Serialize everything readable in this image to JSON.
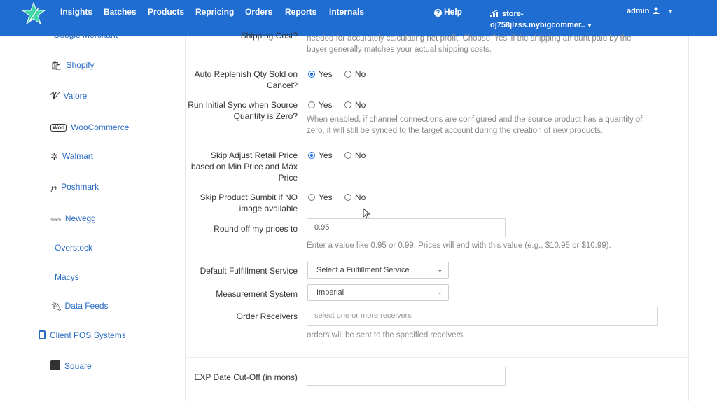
{
  "nav": {
    "items": [
      "Insights",
      "Batches",
      "Products",
      "Repricing",
      "Orders",
      "Reports",
      "Internals"
    ],
    "help": "Help",
    "store_line1": "store-",
    "store_line2": "oj758jlzss.mybigcommer..",
    "admin": "admin"
  },
  "sidebar": {
    "cut_item": "Google Merchant",
    "items": [
      {
        "label": "Shopify",
        "icon": "shopify-icon"
      },
      {
        "label": "Valore",
        "icon": "valore-icon"
      },
      {
        "label": "WooCommerce",
        "icon": "woocommerce-icon"
      },
      {
        "label": "Walmart",
        "icon": "walmart-icon"
      },
      {
        "label": "Poshmark",
        "icon": "poshmark-icon"
      },
      {
        "label": "Newegg",
        "icon": "newegg-icon"
      },
      {
        "label": "Overstock",
        "icon": ""
      },
      {
        "label": "Macys",
        "icon": ""
      },
      {
        "label": "Data Feeds",
        "icon": "plug-icon"
      },
      {
        "label": "Client POS Systems",
        "icon": "tablet-icon"
      },
      {
        "label": "Square",
        "icon": "square-icon"
      }
    ]
  },
  "form": {
    "shipping_cost_label": "Shipping Cost?",
    "shipping_help_1": "needed for accurately calculating net profit. Choose 'Yes' if the shipping amount paid by the",
    "shipping_help_2": "buyer generally matches your actual shipping costs.",
    "auto_replenish_label_1": "Auto Replenish Qty Sold on",
    "auto_replenish_label_2": "Cancel?",
    "initial_sync_label_1": "Run Initial Sync when Source",
    "initial_sync_label_2": "Quantity is Zero?",
    "initial_sync_help_1": "When enabled, if channel connections are configured and the source product has a quantity of",
    "initial_sync_help_2": "zero, it will still be synced to the target account during the creation of new products.",
    "skip_adjust_label_1": "Skip Adjust Retail Price",
    "skip_adjust_label_2": "based on Min Price and Max",
    "skip_adjust_label_3": "Price",
    "skip_submit_label_1": "Skip Product Sumbit if NO",
    "skip_submit_label_2": "image available",
    "round_off_label": "Round off my prices to",
    "round_off_value": "0.95",
    "round_off_help": "Enter a value like 0.95 or 0.99. Prices will end with this value (e.g., $10.95 or $10.99).",
    "fulfillment_label": "Default Fulfillment Service",
    "fulfillment_value": "Select a Fulfillment Service",
    "measurement_label": "Measurement System",
    "measurement_value": "Imperial",
    "receivers_label": "Order Receivers",
    "receivers_placeholder": "select one or more receivers",
    "receivers_help": "orders will be sent to the specified receivers",
    "exp_label": "EXP Date Cut-Off (in mons)",
    "yes": "Yes",
    "no": "No"
  },
  "radios": {
    "auto_replenish": "yes",
    "initial_sync": "none",
    "skip_adjust": "yes",
    "skip_submit": "none"
  },
  "colors": {
    "topbar": "#1f6dd1",
    "link": "#2a6cc2",
    "accent": "#1a73e8"
  }
}
